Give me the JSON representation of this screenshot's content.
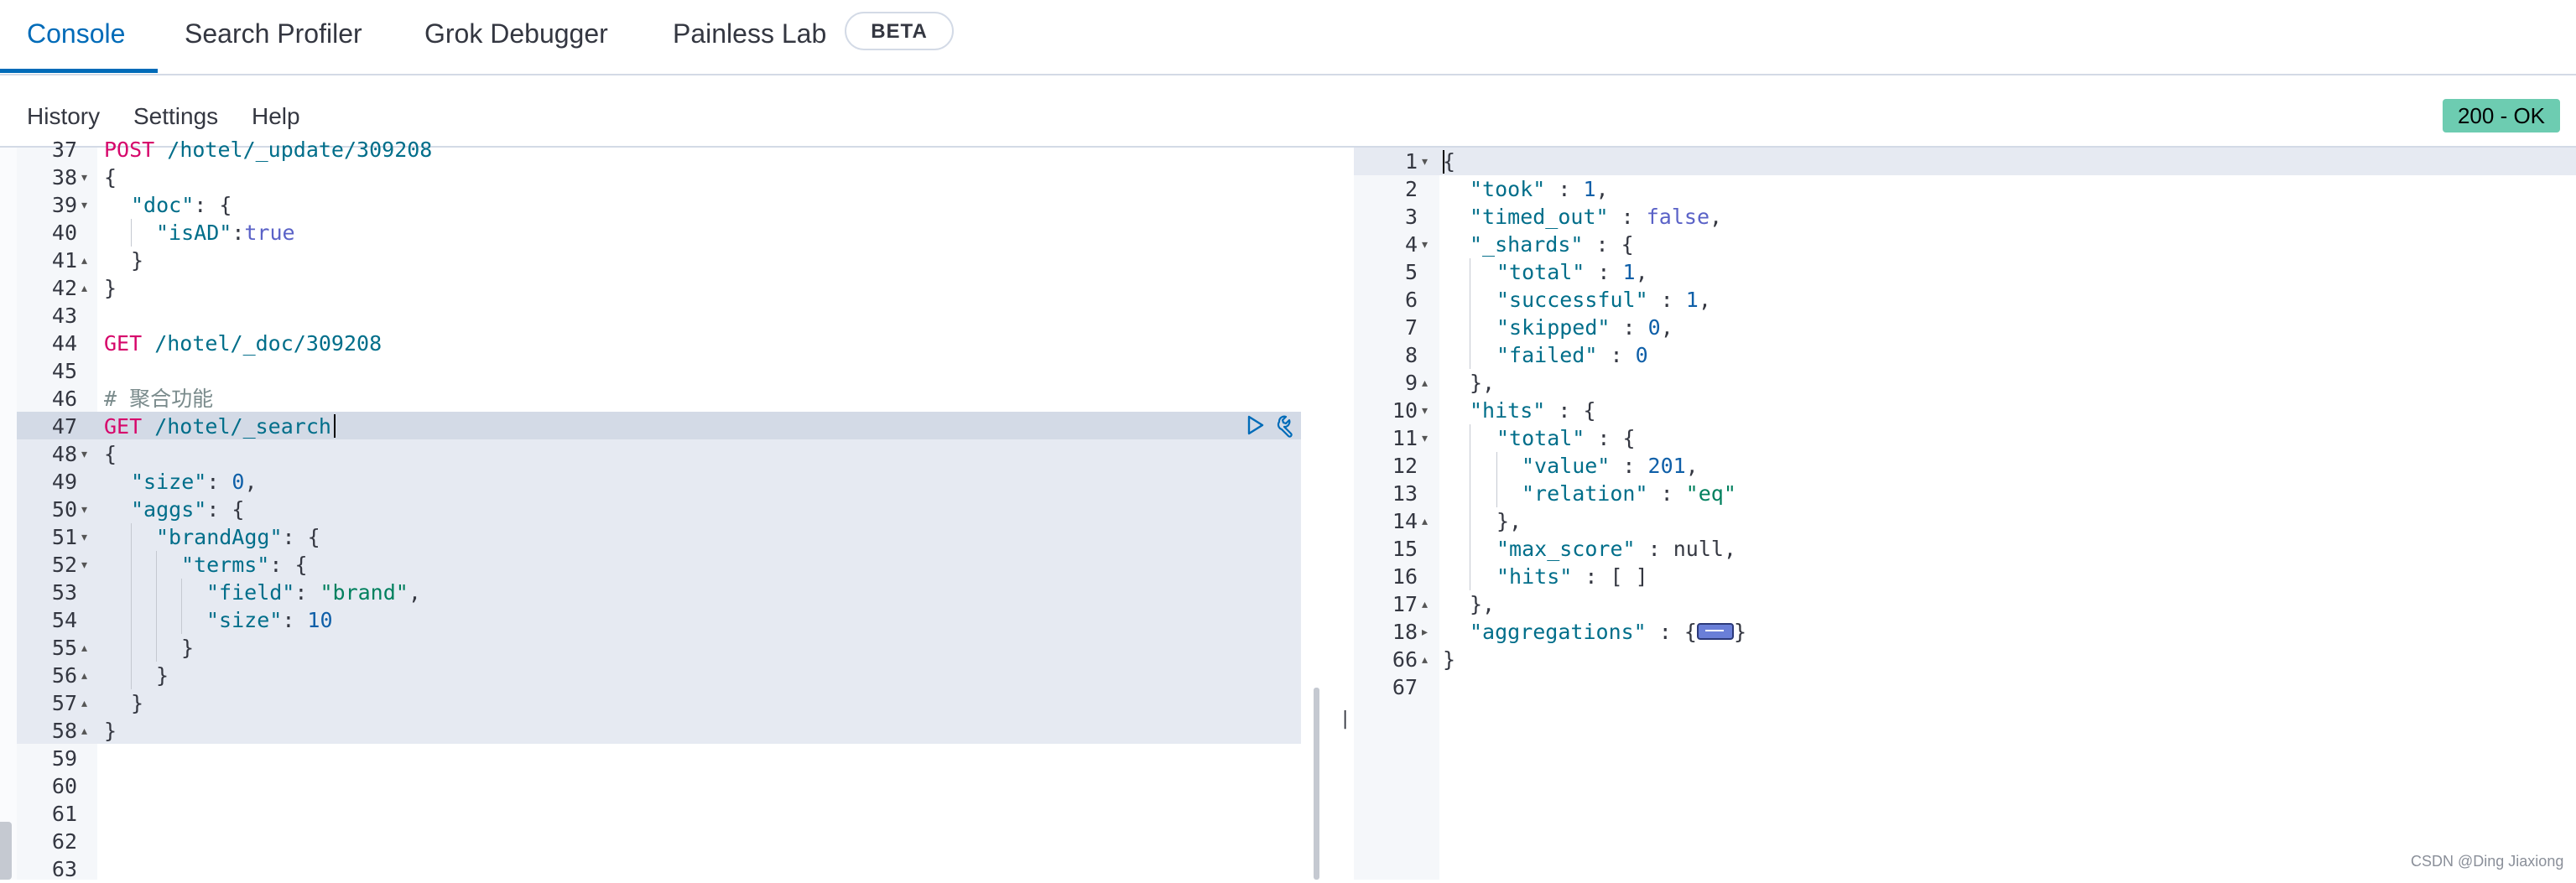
{
  "tabs": [
    {
      "label": "Console",
      "active": true
    },
    {
      "label": "Search Profiler",
      "active": false
    },
    {
      "label": "Grok Debugger",
      "active": false
    },
    {
      "label": "Painless Lab",
      "active": false
    }
  ],
  "beta_badge": "BETA",
  "subnav": [
    "History",
    "Settings",
    "Help"
  ],
  "status": "200 - OK",
  "splitter_label": "||",
  "watermark": "CSDN @Ding Jiaxiong",
  "left_editor": {
    "line_numbers": [
      "37",
      "38",
      "39",
      "40",
      "41",
      "42",
      "43",
      "44",
      "45",
      "46",
      "47",
      "48",
      "49",
      "50",
      "51",
      "52",
      "53",
      "54",
      "55",
      "56",
      "57",
      "58",
      "59",
      "60",
      "61",
      "62",
      "63"
    ],
    "code": {
      "l37_method": "POST",
      "l37_path": " /hotel/_update/309208",
      "l38": "{",
      "l39_key": "\"doc\"",
      "l39_rest": ": {",
      "l40_key": "\"isAD\"",
      "l40_colon": ":",
      "l40_val": "true",
      "l41": "}",
      "l42": "}",
      "l44_method": "GET",
      "l44_path": " /hotel/_doc/309208",
      "l46_comment": "# 聚合功能",
      "l47_method": "GET",
      "l47_path": " /hotel/_search",
      "l48": "{",
      "l49_key": "\"size\"",
      "l49_colon": ": ",
      "l49_val": "0",
      "l49_comma": ",",
      "l50_key": "\"aggs\"",
      "l50_rest": ": {",
      "l51_key": "\"brandAgg\"",
      "l51_rest": ": {",
      "l52_key": "\"terms\"",
      "l52_rest": ": {",
      "l53_key": "\"field\"",
      "l53_colon": ": ",
      "l53_val": "\"brand\"",
      "l53_comma": ",",
      "l54_key": "\"size\"",
      "l54_colon": ": ",
      "l54_val": "10",
      "l55": "}",
      "l56": "}",
      "l57": "}",
      "l58": "}"
    }
  },
  "right_editor": {
    "line_numbers": [
      "1",
      "2",
      "3",
      "4",
      "5",
      "6",
      "7",
      "8",
      "9",
      "10",
      "11",
      "12",
      "13",
      "14",
      "15",
      "16",
      "17",
      "18",
      "66",
      "67"
    ],
    "code": {
      "r1": "{",
      "r2_key": "\"took\"",
      "r2_colon": " : ",
      "r2_val": "1",
      "r2_comma": ",",
      "r3_key": "\"timed_out\"",
      "r3_colon": " : ",
      "r3_val": "false",
      "r3_comma": ",",
      "r4_key": "\"_shards\"",
      "r4_rest": " : {",
      "r5_key": "\"total\"",
      "r5_colon": " : ",
      "r5_val": "1",
      "r5_comma": ",",
      "r6_key": "\"successful\"",
      "r6_colon": " : ",
      "r6_val": "1",
      "r6_comma": ",",
      "r7_key": "\"skipped\"",
      "r7_colon": " : ",
      "r7_val": "0",
      "r7_comma": ",",
      "r8_key": "\"failed\"",
      "r8_colon": " : ",
      "r8_val": "0",
      "r9": "},",
      "r10_key": "\"hits\"",
      "r10_rest": " : {",
      "r11_key": "\"total\"",
      "r11_rest": " : {",
      "r12_key": "\"value\"",
      "r12_colon": " : ",
      "r12_val": "201",
      "r12_comma": ",",
      "r13_key": "\"relation\"",
      "r13_colon": " : ",
      "r13_val": "\"eq\"",
      "r14": "},",
      "r15_key": "\"max_score\"",
      "r15_rest": " : null,",
      "r16_key": "\"hits\"",
      "r16_rest": " : [ ]",
      "r17": "},",
      "r18_key": "\"aggregations\"",
      "r18_open": " : {",
      "r18_close": "}",
      "r66": "}"
    }
  }
}
